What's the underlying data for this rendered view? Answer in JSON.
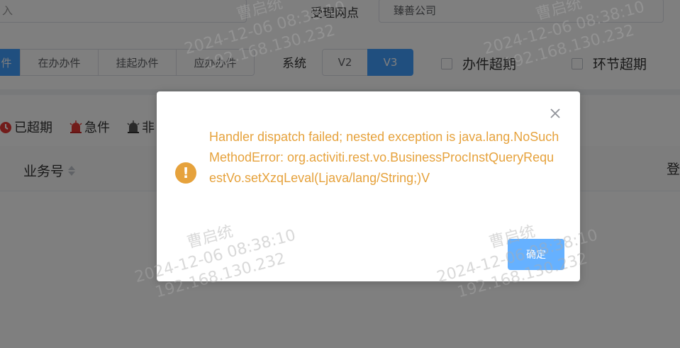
{
  "filters": {
    "left_input_value": "入",
    "unit_label": "受理网点",
    "unit_value": "臻善公司",
    "tabs": [
      "件",
      "在办办件",
      "挂起办件",
      "应办办件"
    ],
    "active_tab_index": 0,
    "system_label": "系统",
    "system_options": [
      "V2",
      "V3"
    ],
    "system_selected": "V3",
    "check_overdue": "办件超期",
    "check_stage_overdue": "环节超期"
  },
  "legend": {
    "overdue": "已超期",
    "urgent": "急件",
    "non": "非"
  },
  "table": {
    "col_business_no": "业务号",
    "col_right_partial": "登"
  },
  "dialog": {
    "message": "Handler dispatch failed; nested exception is java.lang.NoSuchMethodError: org.activiti.rest.vo.BusinessProcInstQueryRequestVo.setXzqLeval(Ljava/lang/String;)V",
    "ok_label": "确定",
    "warning_symbol": "!",
    "colors": {
      "warning": "#e6a23c",
      "primary": "#409eff"
    }
  },
  "watermark": {
    "name": "曹启统",
    "datetime": "2024-12-06 08:38:10",
    "ip": "192.168.130.232"
  }
}
